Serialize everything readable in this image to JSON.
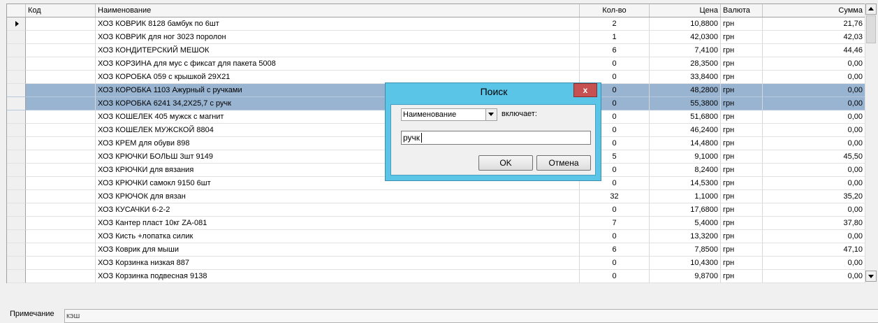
{
  "table": {
    "columns": [
      {
        "key": "code",
        "label": "Код"
      },
      {
        "key": "name",
        "label": "Наименование"
      },
      {
        "key": "qty",
        "label": "Кол-во"
      },
      {
        "key": "price",
        "label": "Цена"
      },
      {
        "key": "currency",
        "label": "Валюта"
      },
      {
        "key": "sum",
        "label": "Сумма"
      }
    ],
    "rows": [
      {
        "code": "",
        "name": "ХОЗ КОВРИК 8128 бамбук по 6шт",
        "qty": "2",
        "price": "10,8800",
        "currency": "грн",
        "sum": "21,76",
        "current": true,
        "selected": false
      },
      {
        "code": "",
        "name": "ХОЗ КОВРИК для ног 3023 поролон",
        "qty": "1",
        "price": "42,0300",
        "currency": "грн",
        "sum": "42,03",
        "current": false,
        "selected": false
      },
      {
        "code": "",
        "name": "ХОЗ КОНДИТЕРСКИЙ МЕШОК",
        "qty": "6",
        "price": "7,4100",
        "currency": "грн",
        "sum": "44,46",
        "current": false,
        "selected": false
      },
      {
        "code": "",
        "name": "ХОЗ КОРЗИНА для мус с фиксат для пакета 5008",
        "qty": "0",
        "price": "28,3500",
        "currency": "грн",
        "sum": "0,00",
        "current": false,
        "selected": false
      },
      {
        "code": "",
        "name": "ХОЗ КОРОБКА 059 с крышкой 29Х21",
        "qty": "0",
        "price": "33,8400",
        "currency": "грн",
        "sum": "0,00",
        "current": false,
        "selected": false
      },
      {
        "code": "",
        "name": "ХОЗ КОРОБКА 1103 Ажурный с ручками",
        "qty": "0",
        "price": "48,2800",
        "currency": "грн",
        "sum": "0,00",
        "current": false,
        "selected": true
      },
      {
        "code": "",
        "name": "ХОЗ КОРОБКА 6241 34,2Х25,7 с ручк",
        "qty": "0",
        "price": "55,3800",
        "currency": "грн",
        "sum": "0,00",
        "current": false,
        "selected": true
      },
      {
        "code": "",
        "name": "ХОЗ КОШЕЛЕК 405 мужск с магнит",
        "qty": "0",
        "price": "51,6800",
        "currency": "грн",
        "sum": "0,00",
        "current": false,
        "selected": false
      },
      {
        "code": "",
        "name": "ХОЗ КОШЕЛЕК МУЖСКОЙ 8804",
        "qty": "0",
        "price": "46,2400",
        "currency": "грн",
        "sum": "0,00",
        "current": false,
        "selected": false
      },
      {
        "code": "",
        "name": "ХОЗ КРЕМ для обуви 898",
        "qty": "0",
        "price": "14,4800",
        "currency": "грн",
        "sum": "0,00",
        "current": false,
        "selected": false
      },
      {
        "code": "",
        "name": "ХОЗ КРЮЧКИ БОЛЬШ 3шт 9149",
        "qty": "5",
        "price": "9,1000",
        "currency": "грн",
        "sum": "45,50",
        "current": false,
        "selected": false
      },
      {
        "code": "",
        "name": "ХОЗ КРЮЧКИ для вязания",
        "qty": "0",
        "price": "8,2400",
        "currency": "грн",
        "sum": "0,00",
        "current": false,
        "selected": false
      },
      {
        "code": "",
        "name": "ХОЗ КРЮЧКИ самокл 9150 6шт",
        "qty": "0",
        "price": "14,5300",
        "currency": "грн",
        "sum": "0,00",
        "current": false,
        "selected": false
      },
      {
        "code": "",
        "name": "ХОЗ КРЮЧОК для вязан",
        "qty": "32",
        "price": "1,1000",
        "currency": "грн",
        "sum": "35,20",
        "current": false,
        "selected": false
      },
      {
        "code": "",
        "name": "ХОЗ КУСАЧКИ 6-2-2",
        "qty": "0",
        "price": "17,6800",
        "currency": "грн",
        "sum": "0,00",
        "current": false,
        "selected": false
      },
      {
        "code": "",
        "name": "ХОЗ Кантер пласт 10кг ZA-081",
        "qty": "7",
        "price": "5,4000",
        "currency": "грн",
        "sum": "37,80",
        "current": false,
        "selected": false
      },
      {
        "code": "",
        "name": "ХОЗ Кисть +лопатка силик",
        "qty": "0",
        "price": "13,3200",
        "currency": "грн",
        "sum": "0,00",
        "current": false,
        "selected": false
      },
      {
        "code": "",
        "name": "ХОЗ Коврик для мыши",
        "qty": "6",
        "price": "7,8500",
        "currency": "грн",
        "sum": "47,10",
        "current": false,
        "selected": false
      },
      {
        "code": "",
        "name": "ХОЗ Корзинка низкая 887",
        "qty": "0",
        "price": "10,4300",
        "currency": "грн",
        "sum": "0,00",
        "current": false,
        "selected": false
      },
      {
        "code": "",
        "name": "ХОЗ Корзинка подвесная 9138",
        "qty": "0",
        "price": "9,8700",
        "currency": "грн",
        "sum": "0,00",
        "current": false,
        "selected": false
      }
    ]
  },
  "note": {
    "label": "Примечание",
    "value": "кэш"
  },
  "dialog": {
    "title": "Поиск",
    "close_label": "x",
    "field_select_value": "Наименование",
    "contains_label": "включает:",
    "search_value": "ручк",
    "ok_label": "OK",
    "cancel_label": "Отмена"
  },
  "colors": {
    "selection": "#99b4d1",
    "dialog_frame": "#5bc5e8",
    "close_button": "#c75050"
  }
}
